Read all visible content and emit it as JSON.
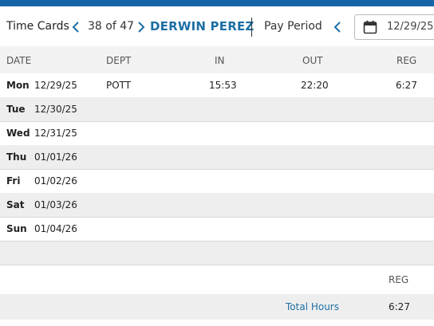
{
  "toolbar": {
    "title": "Time Cards",
    "counter": "38 of 47",
    "employee_name": "DERWIN PEREZ",
    "pay_period_label": "Pay Period",
    "pay_period_date": "12/29/25"
  },
  "colors": {
    "accent": "#1d6fa5",
    "top_bar": "#1565a8",
    "row_alt": "#eeeeee",
    "header_bg": "#f2f2f2"
  },
  "icons": [
    "chevron-left-icon",
    "chevron-right-icon",
    "calendar-icon"
  ],
  "table": {
    "columns": [
      "DATE",
      "DEPT",
      "IN",
      "OUT",
      "REG"
    ],
    "rows": [
      {
        "dow": "Mon",
        "date": "12/29/25",
        "dept": "POTT",
        "in": "15:53",
        "out": "22:20",
        "reg": "6:27"
      },
      {
        "dow": "Tue",
        "date": "12/30/25",
        "dept": "",
        "in": "",
        "out": "",
        "reg": ""
      },
      {
        "dow": "Wed",
        "date": "12/31/25",
        "dept": "",
        "in": "",
        "out": "",
        "reg": ""
      },
      {
        "dow": "Thu",
        "date": "01/01/26",
        "dept": "",
        "in": "",
        "out": "",
        "reg": ""
      },
      {
        "dow": "Fri",
        "date": "01/02/26",
        "dept": "",
        "in": "",
        "out": "",
        "reg": ""
      },
      {
        "dow": "Sat",
        "date": "01/03/26",
        "dept": "",
        "in": "",
        "out": "",
        "reg": ""
      },
      {
        "dow": "Sun",
        "date": "01/04/26",
        "dept": "",
        "in": "",
        "out": "",
        "reg": ""
      }
    ]
  },
  "totals": {
    "column": "REG",
    "label": "Total Hours",
    "reg": "6:27"
  }
}
